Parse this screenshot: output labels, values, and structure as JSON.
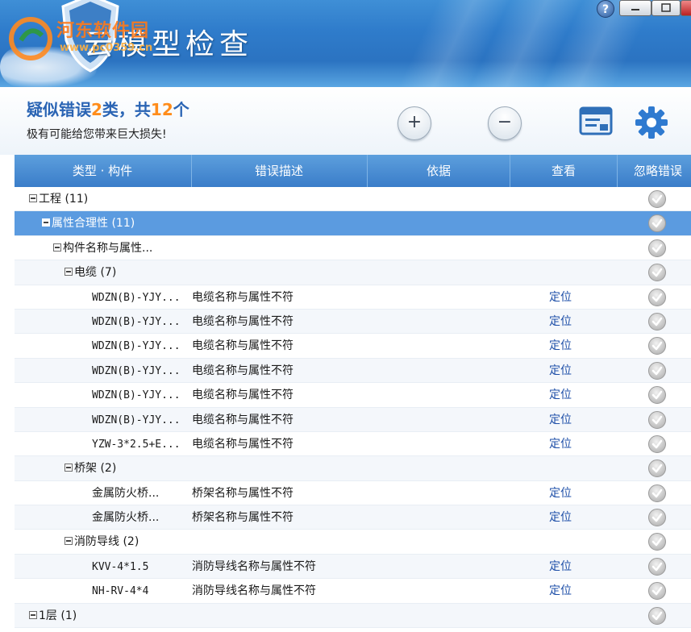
{
  "app": {
    "title": "云模型检查",
    "watermark_line1": "河东软件园",
    "watermark_line2": "www.pc0359.cn"
  },
  "window_controls": {
    "help": "?"
  },
  "summary": {
    "prefix": "疑似错误",
    "types_count": "2",
    "middle": "类，共",
    "total_count": "12",
    "suffix": "个",
    "subtitle": "极有可能给您带来巨大损失!"
  },
  "toolbar": {
    "expand_label": "+",
    "collapse_label": "−"
  },
  "colors": {
    "header_blue": "#3a7dc9",
    "selected_row": "#5b9be0",
    "summary_accent": "#ff8c1a",
    "summary_blue": "#2a64b4"
  },
  "table": {
    "headers": [
      "类型 · 构件",
      "错误描述",
      "依据",
      "查看",
      "忽略错误"
    ],
    "rows": [
      {
        "label": "工程 (11)",
        "level": 0,
        "group": true,
        "description": "",
        "action": ""
      },
      {
        "label": "属性合理性 (11)",
        "level": 1,
        "group": true,
        "description": "",
        "action": "",
        "selected": true
      },
      {
        "label": "构件名称与属性...",
        "level": 2,
        "group": true,
        "description": "",
        "action": ""
      },
      {
        "label": "电缆 (7)",
        "level": 3,
        "group": true,
        "description": "",
        "action": ""
      },
      {
        "label": "WDZN(B)-YJY...",
        "level": 4,
        "group": false,
        "description": "电缆名称与属性不符",
        "action": "定位"
      },
      {
        "label": "WDZN(B)-YJY...",
        "level": 4,
        "group": false,
        "description": "电缆名称与属性不符",
        "action": "定位"
      },
      {
        "label": "WDZN(B)-YJY...",
        "level": 4,
        "group": false,
        "description": "电缆名称与属性不符",
        "action": "定位"
      },
      {
        "label": "WDZN(B)-YJY...",
        "level": 4,
        "group": false,
        "description": "电缆名称与属性不符",
        "action": "定位"
      },
      {
        "label": "WDZN(B)-YJY...",
        "level": 4,
        "group": false,
        "description": "电缆名称与属性不符",
        "action": "定位"
      },
      {
        "label": "WDZN(B)-YJY...",
        "level": 4,
        "group": false,
        "description": "电缆名称与属性不符",
        "action": "定位"
      },
      {
        "label": "YZW-3*2.5+E...",
        "level": 4,
        "group": false,
        "description": "电缆名称与属性不符",
        "action": "定位"
      },
      {
        "label": "桥架 (2)",
        "level": 3,
        "group": true,
        "description": "",
        "action": ""
      },
      {
        "label": "金属防火桥...",
        "level": 4,
        "group": false,
        "description": "桥架名称与属性不符",
        "action": "定位"
      },
      {
        "label": "金属防火桥...",
        "level": 4,
        "group": false,
        "description": "桥架名称与属性不符",
        "action": "定位"
      },
      {
        "label": "消防导线 (2)",
        "level": 3,
        "group": true,
        "description": "",
        "action": ""
      },
      {
        "label": "KVV-4*1.5",
        "level": 4,
        "group": false,
        "description": "消防导线名称与属性不符",
        "action": "定位"
      },
      {
        "label": "NH-RV-4*4",
        "level": 4,
        "group": false,
        "description": "消防导线名称与属性不符",
        "action": "定位"
      },
      {
        "label": "1层 (1)",
        "level": 0,
        "group": true,
        "description": "",
        "action": ""
      }
    ]
  }
}
